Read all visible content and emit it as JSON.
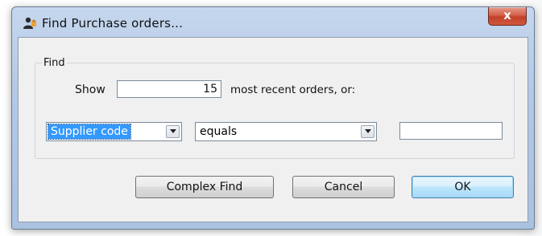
{
  "window": {
    "title": "Find Purchase orders...",
    "close_glyph": "x",
    "title_icon": "person-icon"
  },
  "find_group": {
    "label": "Find",
    "show_label": "Show",
    "recent_count": "15",
    "recent_suffix": "most recent orders, or:",
    "field_select": {
      "value": "Supplier code",
      "state": "selected"
    },
    "operator_select": {
      "value": "equals"
    },
    "value_input": {
      "value": ""
    }
  },
  "buttons": {
    "complex_find": "Complex Find",
    "cancel": "Cancel",
    "ok": "OK"
  },
  "colors": {
    "selection": "#3399ff",
    "close_button": "#c1412b",
    "default_button_border": "#3c7fb1",
    "client_background": "#f0f0f0"
  }
}
